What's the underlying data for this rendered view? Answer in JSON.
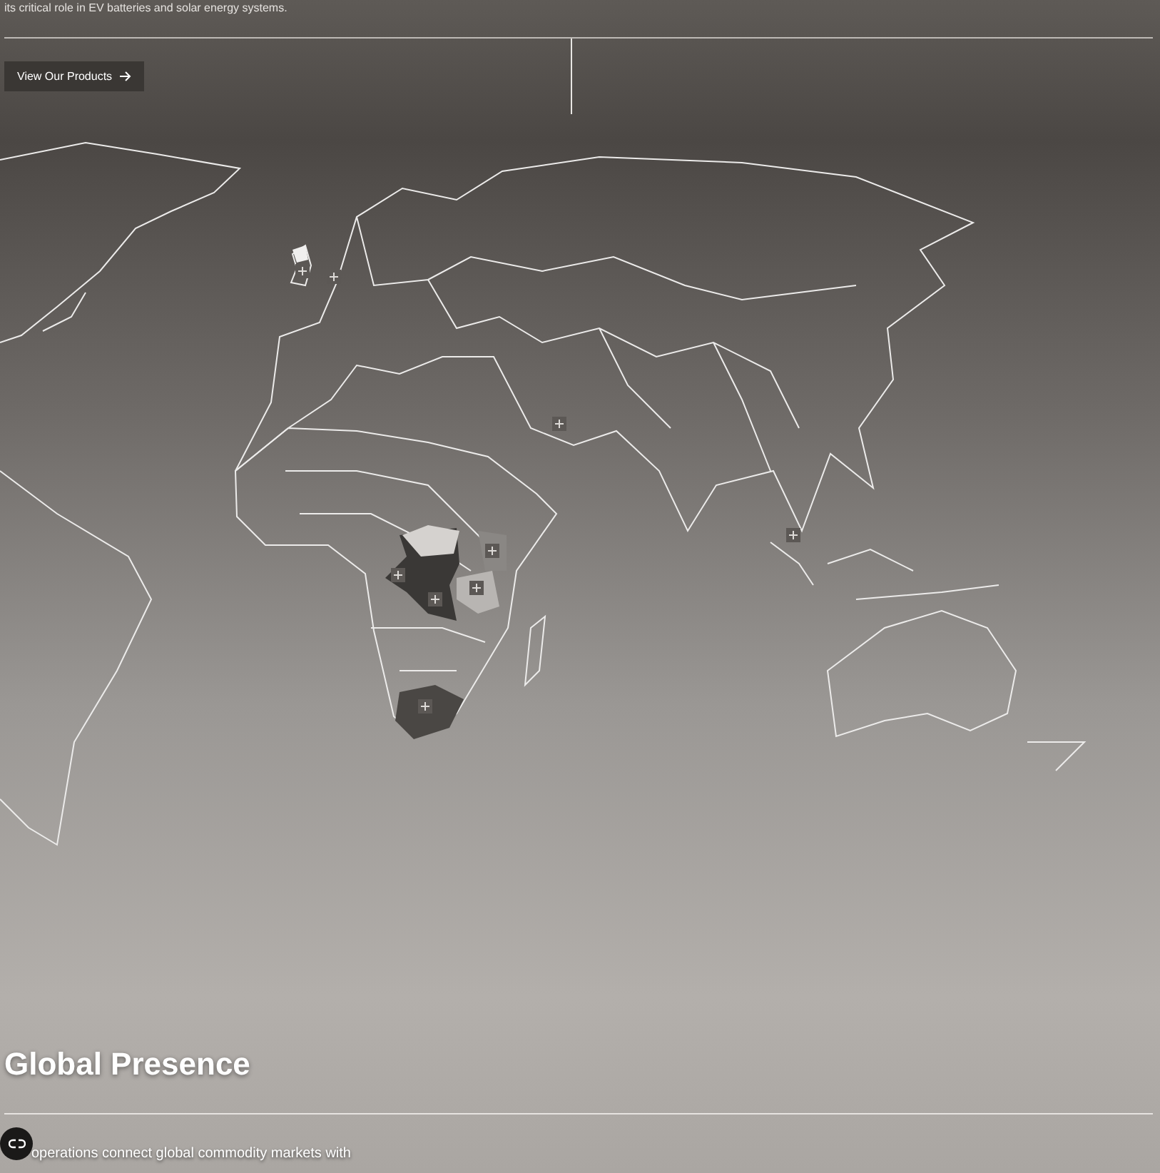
{
  "intro": {
    "text": "its critical role in EV batteries and solar energy systems."
  },
  "cta": {
    "label": "View Our Products"
  },
  "section": {
    "title": "Global Presence",
    "description": "operations connect global commodity markets with"
  }
}
